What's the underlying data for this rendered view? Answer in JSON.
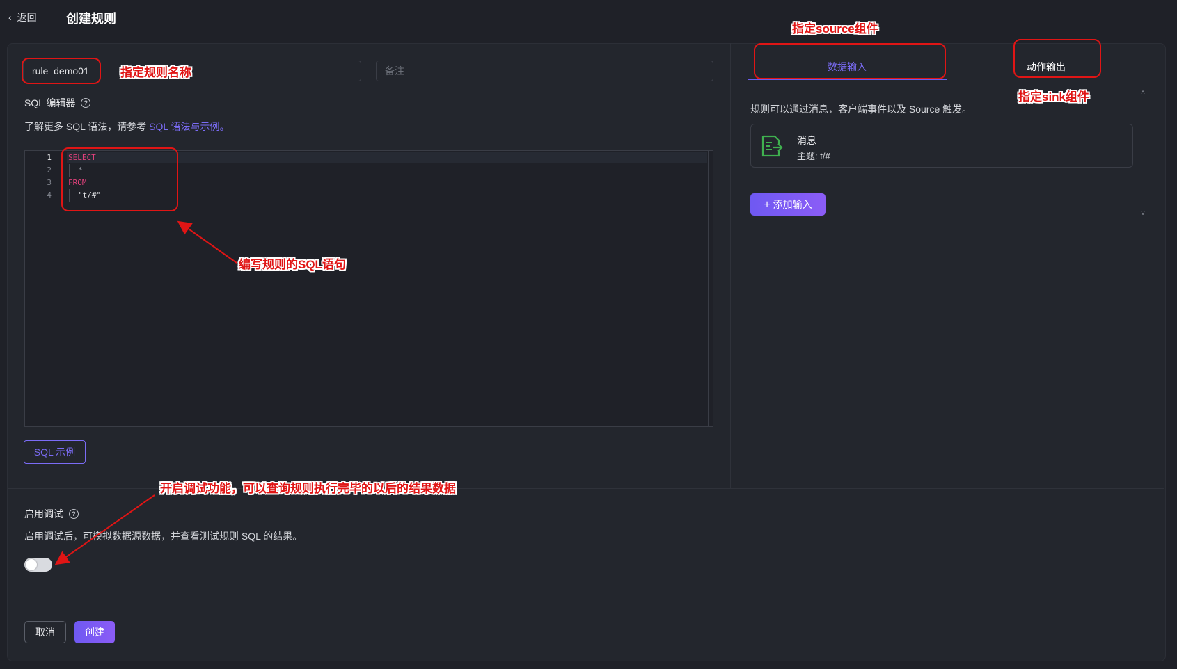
{
  "header": {
    "back_label": "返回",
    "title": "创建规则"
  },
  "form": {
    "rule_name_value": "rule_demo01",
    "note_placeholder": "备注",
    "sql_editor_label": "SQL 编辑器",
    "sql_hint_prefix": "了解更多 SQL 语法，请参考 ",
    "sql_hint_link": "SQL 语法与示例",
    "sql_hint_suffix": "。",
    "sql_lines": [
      {
        "no": "1",
        "text": "SELECT"
      },
      {
        "no": "2",
        "text": "*"
      },
      {
        "no": "3",
        "text": "FROM"
      },
      {
        "no": "4",
        "text": "\"t/#\""
      }
    ],
    "sql_example_button": "SQL 示例"
  },
  "right_panel": {
    "tabs": [
      {
        "label": "数据输入",
        "active": true
      },
      {
        "label": "动作输出",
        "active": false
      }
    ],
    "description": "规则可以通过消息，客户端事件以及 Source 触发。",
    "source": {
      "icon": "message-input-icon",
      "name": "消息",
      "topic": "主题: t/#"
    },
    "add_input_button": "添加输入"
  },
  "debug": {
    "label": "启用调试",
    "description": "启用调试后，可模拟数据源数据，并查看测试规则 SQL 的结果。",
    "enabled": false
  },
  "footer": {
    "cancel_button": "取消",
    "create_button": "创建"
  },
  "annotations": {
    "rule_name": "指定规则名称",
    "source_component": "指定source组件",
    "sink_component": "指定sink组件",
    "sql_statement": "编写规则的SQL语句",
    "debug_feature": "开启调试功能，可以查询规则执行完毕的以后的结果数据"
  },
  "colors": {
    "accent": "#7b6cf6",
    "annotation_red": "#e01515",
    "background": "#1f2128"
  }
}
